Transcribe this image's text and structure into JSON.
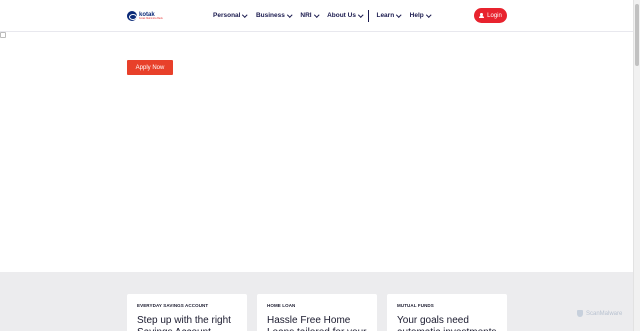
{
  "brand": {
    "name": "kotak",
    "tagline": "Kotak Mahindra Bank"
  },
  "nav": {
    "items": [
      {
        "label": "Personal"
      },
      {
        "label": "Business"
      },
      {
        "label": "NRI"
      },
      {
        "label": "About Us"
      },
      {
        "label": "Learn"
      },
      {
        "label": "Help"
      }
    ],
    "login_label": "Login"
  },
  "hero": {
    "apply_label": "Apply Now"
  },
  "cards": [
    {
      "tag": "EVERYDAY SAVINGS ACCOUNT",
      "title": "Step up with the right Savings Account"
    },
    {
      "tag": "HOME LOAN",
      "title": "Hassle Free Home Loans tailored for your"
    },
    {
      "tag": "MUTUAL FUNDS",
      "title": "Your goals need automatic investments"
    }
  ],
  "watermark": {
    "label": "ScanMalware"
  },
  "colors": {
    "brand_navy": "#0b2a78",
    "login_red": "#e8232e",
    "apply_orange": "#e8402a"
  }
}
